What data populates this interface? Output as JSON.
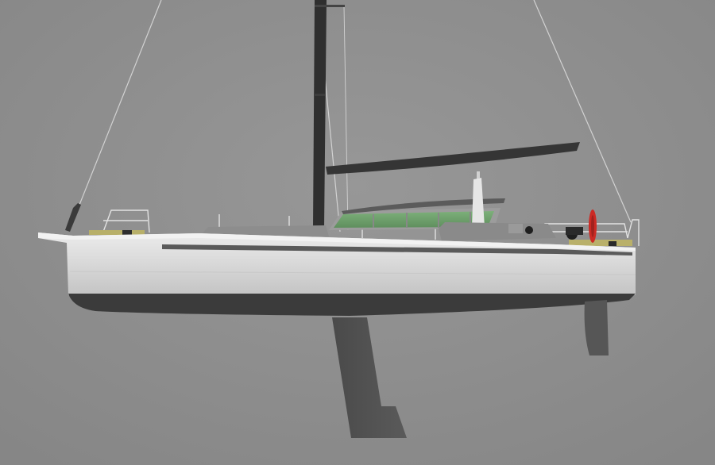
{
  "scene": {
    "subject": "sailboat-side-profile-render"
  },
  "colors": {
    "background": "#8e8e8e",
    "hull_topsides": "#dcdcdc",
    "hull_bottom": "#3b3b3b",
    "appendages": "#505050",
    "mast": "#2e2e2e",
    "boom": "#343434",
    "deckhouse_glass": "#6fa06f",
    "life_ring": "#cc2a24",
    "teak_deck": "#b9b06a"
  }
}
